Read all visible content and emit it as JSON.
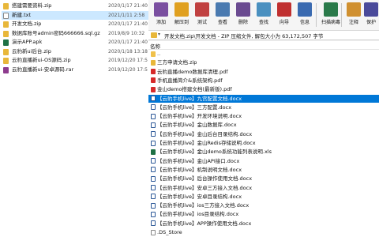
{
  "explorer": {
    "files": [
      {
        "name": "搭建需要资料.zip",
        "date": "2020/1/17 21:40",
        "type": "zip",
        "selected": false
      },
      {
        "name": "新建.txt",
        "date": "2021/1/11 2:58",
        "type": "txt",
        "selected": true
      },
      {
        "name": "开发文档.zip",
        "date": "2020/1/17 21:40",
        "type": "zip",
        "selected": false
      },
      {
        "name": "数据库账号admin密码666666.sql.gz",
        "date": "2019/8/9 10:32",
        "type": "gz",
        "selected": false
      },
      {
        "name": "演示APP.apk",
        "date": "2020/1/17 21:40",
        "type": "apk",
        "selected": false
      },
      {
        "name": "云豹新ui后台.zip",
        "date": "2020/1/18 13:18",
        "type": "zip",
        "selected": false
      },
      {
        "name": "云豹直播新ui-OS源码.zip",
        "date": "2019/12/20 17:5",
        "type": "zip",
        "selected": false
      },
      {
        "name": "云豹直播新ui-安卓源码.rar",
        "date": "2019/12/20 17:5",
        "type": "rar",
        "selected": false
      }
    ]
  },
  "toolbar": {
    "buttons": [
      {
        "label": "添加",
        "icon": "add-icon",
        "color": "#7a4fa0"
      },
      {
        "label": "解压到",
        "icon": "extract-icon",
        "color": "#e0a020"
      },
      {
        "label": "测试",
        "icon": "test-icon",
        "color": "#c04040"
      },
      {
        "label": "查看",
        "icon": "view-icon",
        "color": "#4a7ab0"
      },
      {
        "label": "删除",
        "icon": "delete-icon",
        "color": "#6a4a90"
      },
      {
        "label": "查找",
        "icon": "find-icon",
        "color": "#4a90c0"
      },
      {
        "label": "向导",
        "icon": "wizard-icon",
        "color": "#c03030"
      },
      {
        "label": "信息",
        "icon": "info-icon",
        "color": "#3a6ab0"
      },
      {
        "label": "扫描病毒",
        "icon": "scan-virus-icon",
        "color": "#2a7a4a"
      },
      {
        "label": "注释",
        "icon": "comment-icon",
        "color": "#d09030"
      },
      {
        "label": "保护",
        "icon": "protect-icon",
        "color": "#4a4a9a"
      }
    ]
  },
  "address": {
    "text": "开发文档.zip\\开发文档 - ZIP 压缩文件, 解包大小为 63,172,507 字节"
  },
  "list": {
    "column_header": "名称",
    "items": [
      {
        "name": "..",
        "type": "up",
        "selected": false
      },
      {
        "name": "三方申请文档.zip",
        "type": "zip",
        "selected": false
      },
      {
        "name": "云豹直播demo数据库清理.pdf",
        "type": "pdf",
        "selected": false
      },
      {
        "name": "手机直播简介&系统架构.pdf",
        "type": "pdf",
        "selected": false
      },
      {
        "name": "金山demo搭建文档(最新版).pdf",
        "type": "pdf",
        "selected": false
      },
      {
        "name": "【云豹手机live】九宫配置文档.docx",
        "type": "doc",
        "selected": true
      },
      {
        "name": "【云豹手机live】三方配置.docx",
        "type": "doc",
        "selected": false
      },
      {
        "name": "【云豹手机live】开发环境说明.docx",
        "type": "doc",
        "selected": false
      },
      {
        "name": "【云豹手机live】金山数据库.docx",
        "type": "doc",
        "selected": false
      },
      {
        "name": "【云豹手机live】金山后台目录结构.docx",
        "type": "doc",
        "selected": false
      },
      {
        "name": "【云豹手机live】金山Redis存储说明.docx",
        "type": "doc",
        "selected": false
      },
      {
        "name": "【云豹手机live】金山demo系统功能列表说明.xls",
        "type": "xls",
        "selected": false
      },
      {
        "name": "【云豹手机live】金山API接口.docx",
        "type": "doc",
        "selected": false
      },
      {
        "name": "【云豹手机live】机制说明文档.docx",
        "type": "doc",
        "selected": false
      },
      {
        "name": "【云豹手机live】后台操作使用文档.docx",
        "type": "doc",
        "selected": false
      },
      {
        "name": "【云豹手机live】安卓三方接入文档.docx",
        "type": "doc",
        "selected": false
      },
      {
        "name": "【云豹手机live】安卓目录结构.docx",
        "type": "doc",
        "selected": false
      },
      {
        "name": "【云豹手机live】ios三方接入文档.docx",
        "type": "doc",
        "selected": false
      },
      {
        "name": "【云豹手机live】ios目录结构.docx",
        "type": "doc",
        "selected": false
      },
      {
        "name": "【云豹手机live】APP操作使用文档.docx",
        "type": "doc",
        "selected": false
      },
      {
        "name": ".DS_Store",
        "type": "txt",
        "selected": false
      }
    ]
  }
}
